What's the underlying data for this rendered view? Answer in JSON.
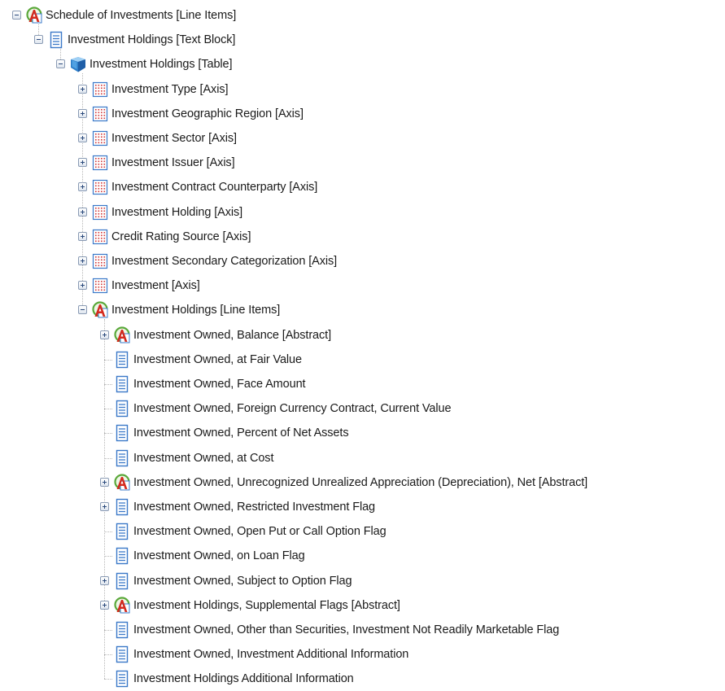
{
  "tree": {
    "nodes": [
      {
        "label": "Schedule of Investments [Line Items]",
        "type": "abstract",
        "level": 0,
        "toggle": "minus"
      },
      {
        "label": "Investment Holdings [Text Block]",
        "type": "element",
        "level": 1,
        "toggle": "minus"
      },
      {
        "label": "Investment Holdings [Table]",
        "type": "table",
        "level": 2,
        "toggle": "minus"
      },
      {
        "label": "Investment Type [Axis]",
        "type": "axis",
        "level": 3,
        "toggle": "plus"
      },
      {
        "label": "Investment Geographic Region [Axis]",
        "type": "axis",
        "level": 3,
        "toggle": "plus"
      },
      {
        "label": "Investment Sector [Axis]",
        "type": "axis",
        "level": 3,
        "toggle": "plus"
      },
      {
        "label": "Investment Issuer [Axis]",
        "type": "axis",
        "level": 3,
        "toggle": "plus"
      },
      {
        "label": "Investment Contract Counterparty [Axis]",
        "type": "axis",
        "level": 3,
        "toggle": "plus"
      },
      {
        "label": "Investment Holding [Axis]",
        "type": "axis",
        "level": 3,
        "toggle": "plus"
      },
      {
        "label": "Credit Rating Source [Axis]",
        "type": "axis",
        "level": 3,
        "toggle": "plus"
      },
      {
        "label": "Investment Secondary Categorization [Axis]",
        "type": "axis",
        "level": 3,
        "toggle": "plus"
      },
      {
        "label": "Investment [Axis]",
        "type": "axis",
        "level": 3,
        "toggle": "plus"
      },
      {
        "label": "Investment Holdings [Line Items]",
        "type": "abstract",
        "level": 3,
        "toggle": "minus"
      },
      {
        "label": "Investment Owned, Balance [Abstract]",
        "type": "abstract",
        "level": 4,
        "toggle": "plus"
      },
      {
        "label": "Investment Owned, at Fair Value",
        "type": "element",
        "level": 4,
        "toggle": "none"
      },
      {
        "label": "Investment Owned, Face Amount",
        "type": "element",
        "level": 4,
        "toggle": "none"
      },
      {
        "label": "Investment Owned, Foreign Currency Contract, Current Value",
        "type": "element",
        "level": 4,
        "toggle": "none"
      },
      {
        "label": "Investment Owned, Percent of Net Assets",
        "type": "element",
        "level": 4,
        "toggle": "none"
      },
      {
        "label": "Investment Owned, at Cost",
        "type": "element",
        "level": 4,
        "toggle": "none"
      },
      {
        "label": "Investment Owned, Unrecognized Unrealized Appreciation (Depreciation), Net [Abstract]",
        "type": "abstract",
        "level": 4,
        "toggle": "plus"
      },
      {
        "label": "Investment Owned, Restricted Investment Flag",
        "type": "element",
        "level": 4,
        "toggle": "plus"
      },
      {
        "label": "Investment Owned, Open Put or Call Option Flag",
        "type": "element",
        "level": 4,
        "toggle": "none"
      },
      {
        "label": "Investment Owned, on Loan Flag",
        "type": "element",
        "level": 4,
        "toggle": "none"
      },
      {
        "label": "Investment Owned, Subject to Option Flag",
        "type": "element",
        "level": 4,
        "toggle": "plus"
      },
      {
        "label": "Investment Holdings, Supplemental Flags [Abstract]",
        "type": "abstract",
        "level": 4,
        "toggle": "plus"
      },
      {
        "label": "Investment Owned, Other than Securities, Investment Not Readily Marketable Flag",
        "type": "element",
        "level": 4,
        "toggle": "none"
      },
      {
        "label": "Investment Owned, Investment Additional Information",
        "type": "element",
        "level": 4,
        "toggle": "none"
      },
      {
        "label": "Investment Holdings Additional Information",
        "type": "element",
        "level": 4,
        "toggle": "none"
      }
    ]
  },
  "icons": {
    "abstract": "abstract-a-icon",
    "element": "document-lines-icon",
    "table": "table-cube-icon",
    "axis": "axis-grid-icon"
  },
  "colors": {
    "text": "#1a1a1a",
    "abstract_circle": "#5aa83a",
    "abstract_letter": "#d42a1e",
    "element_blue": "#3a78c8",
    "table_blue": "#2d7ec9",
    "axis_red": "#d23a3a",
    "tree_line": "#b6b6b6"
  }
}
